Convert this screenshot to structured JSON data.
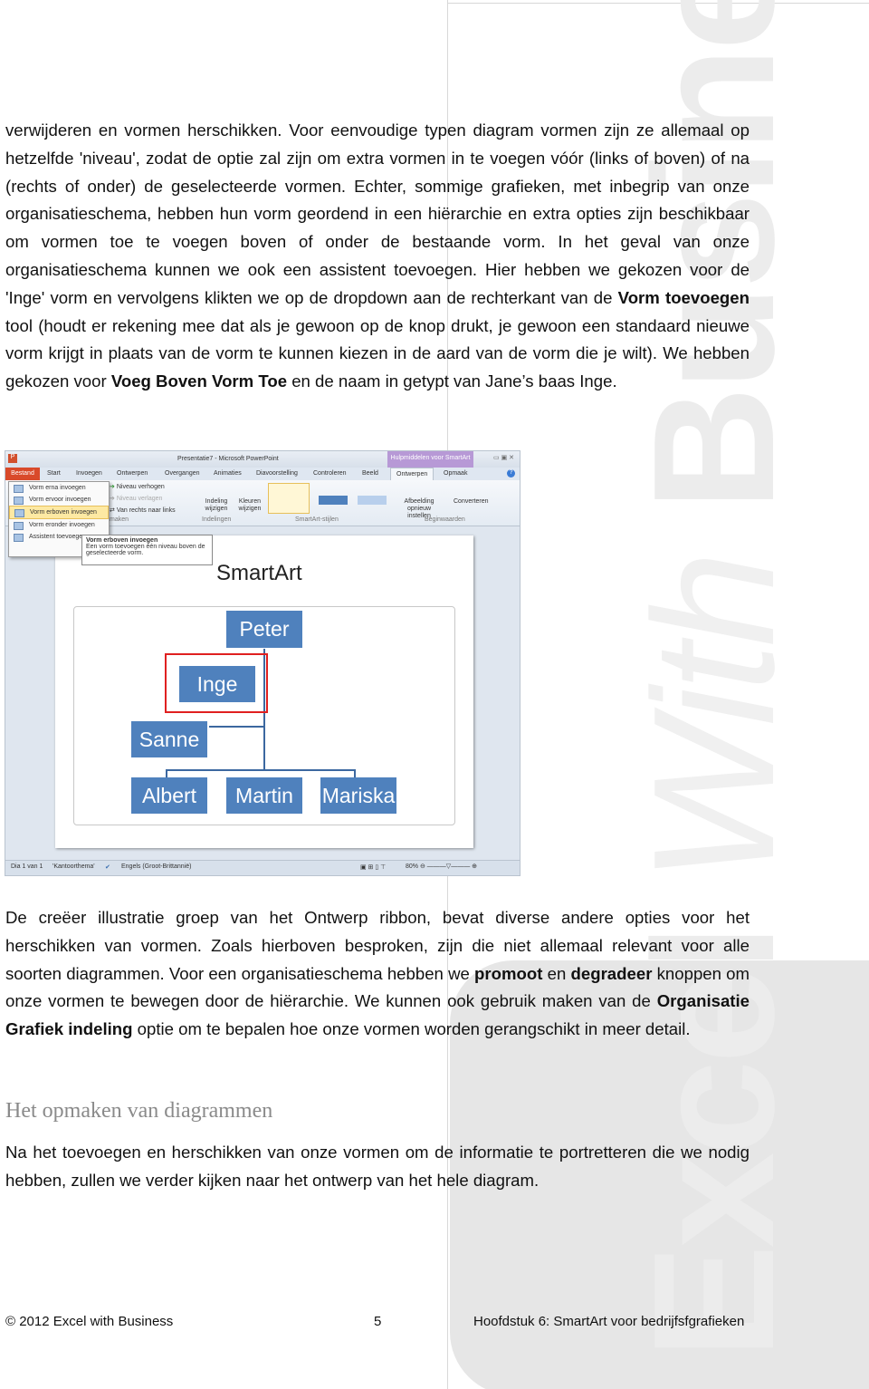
{
  "paragraphs": {
    "p1": "verwijderen en vormen herschikken. Voor eenvoudige typen diagram vormen zijn ze allemaal op hetzelfde 'niveau', zodat de optie zal zijn om extra vormen in te voegen vóór (links of boven) of na (rechts of onder) de geselecteerde vormen. Echter, sommige grafieken, met inbegrip van onze organisatieschema, hebben hun vorm geordend in een hiërarchie en extra opties zijn beschikbaar om vormen toe te voegen boven of onder de bestaande vorm. In het geval van onze organisatieschema kunnen we ook een assistent toevoegen. Hier hebben we gekozen voor de 'Inge' vorm en vervolgens klikten we op de dropdown aan de rechterkant van de ",
    "p1_b1": "Vorm toevoegen",
    "p1_mid": " tool (houdt er rekening mee dat als je gewoon op de knop drukt, je gewoon een standaard nieuwe vorm krijgt in plaats van de vorm te kunnen kiezen in de aard van de vorm die je wilt). We hebben gekozen voor ",
    "p1_b2": "Voeg Boven Vorm Toe",
    "p1_end": " en de naam in getypt van Jane’s baas Inge.",
    "p2_a": "De creëer illustratie groep van het Ontwerp ribbon,  bevat diverse andere opties voor het herschikken van vormen. Zoals hierboven besproken, zijn die niet allemaal relevant voor alle soorten diagrammen. Voor een organisatieschema hebben we ",
    "p2_b1": "promoot",
    "p2_c": " en ",
    "p2_b2": "degradeer",
    "p2_d": " knoppen om onze vormen te bewegen door de hiërarchie. We kunnen ook gebruik maken van de ",
    "p2_b3": "Organisatie Grafiek indeling",
    "p2_e": " optie om te bepalen hoe onze vormen worden gerangschikt in meer detail.",
    "heading": "Het opmaken van diagrammen",
    "p3": "Na het toevoegen en herschikken van onze vormen om de informatie te portretteren die we nodig hebben, zullen we verder kijken naar het ontwerp van het hele diagram."
  },
  "footer": {
    "copyright": "© 2012 Excel with Business",
    "page": "5",
    "chapter": "Hoofdstuk 6: SmartArt voor bedrijfsfgrafieken"
  },
  "watermark": {
    "text1": "Excel ",
    "text2": "With ",
    "text3": "Business"
  },
  "screenshot": {
    "title": "Presentatie7 - Microsoft PowerPoint",
    "context_tab": "Hulpmiddelen voor SmartArt",
    "tabs": [
      "Bestand",
      "Start",
      "Invoegen",
      "Ontwerpen",
      "Overgangen",
      "Animaties",
      "Diavoorstelling",
      "Controleren",
      "Beeld",
      "Ontwerpen",
      "Opmaak"
    ],
    "ribbon": {
      "add_shape": "Vorm toevoegen",
      "promote": "Niveau verhogen",
      "demote": "Niveau verlagen",
      "rtl": "Van rechts naar links",
      "layout": "Indeling wijzigen",
      "colors": "Kleuren wijzigen",
      "reset": "Afbeelding opnieuw instellen",
      "convert": "Converteren",
      "group_create": "maken",
      "group_layouts": "Indelingen",
      "group_styles": "SmartArt-stijlen",
      "group_reset": "Beginwaarden"
    },
    "menu": [
      "Vorm erna invoegen",
      "Vorm ervoor invoegen",
      "Vorm erboven invoegen",
      "Vorm eronder invoegen",
      "Assistent toevoegen"
    ],
    "tooltip": {
      "title": "Vorm erboven invoegen",
      "body": "Een vorm toevoegen één niveau boven de geselecteerde vorm."
    },
    "slide_title": "SmartArt",
    "nodes": {
      "top": "Peter",
      "selected": "Inge",
      "assistant": "Sanne",
      "c1": "Albert",
      "c2": "Martin",
      "c3": "Mariska"
    },
    "status": {
      "slide": "Dia 1 van 1",
      "theme": "'Kantoorthema'",
      "lang": "Engels (Groot-Brittannië)",
      "zoom": "80%"
    }
  }
}
